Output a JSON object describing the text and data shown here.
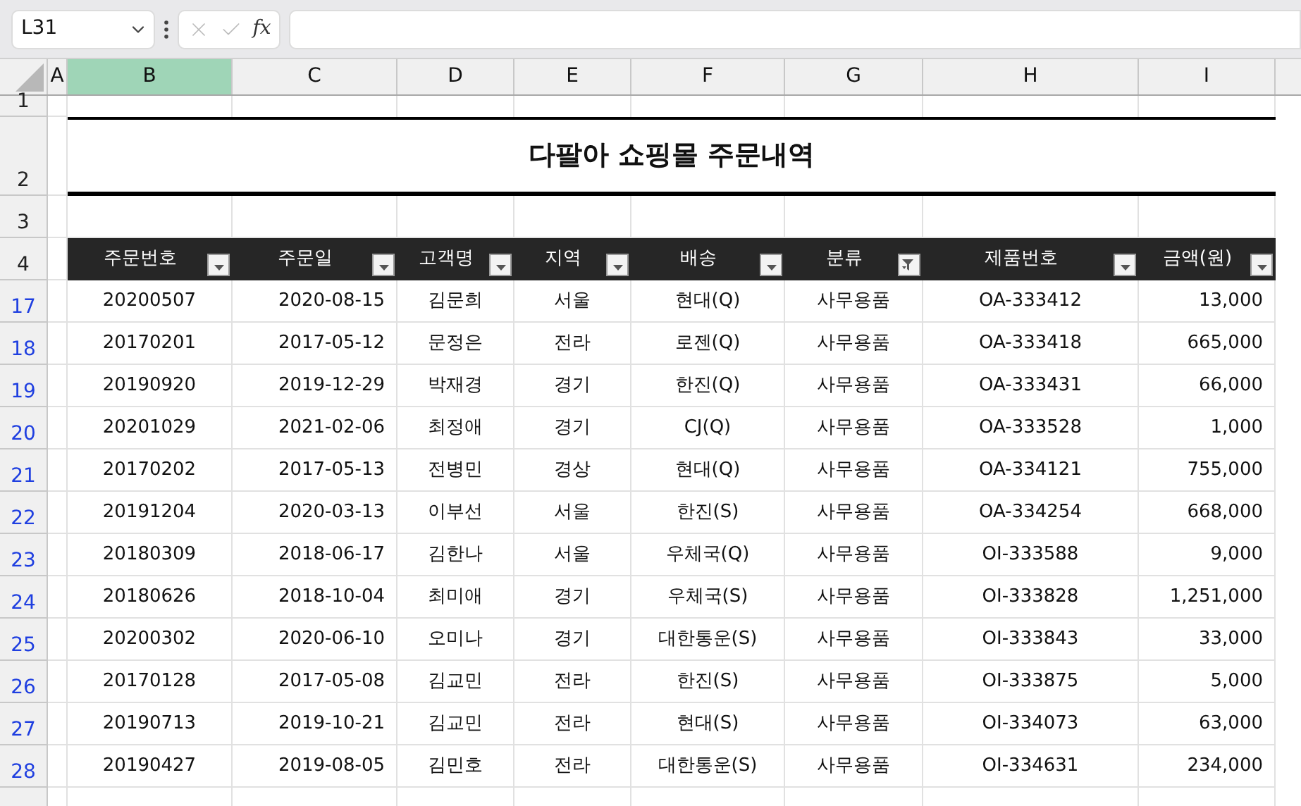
{
  "name_box": {
    "value": "L31"
  },
  "formula_bar": {
    "fx_label": "fx"
  },
  "column_headers": [
    {
      "label": "A",
      "selected": false
    },
    {
      "label": "B",
      "selected": true
    },
    {
      "label": "C",
      "selected": false
    },
    {
      "label": "D",
      "selected": false
    },
    {
      "label": "E",
      "selected": false
    },
    {
      "label": "F",
      "selected": false
    },
    {
      "label": "G",
      "selected": false
    },
    {
      "label": "H",
      "selected": false
    },
    {
      "label": "I",
      "selected": false
    }
  ],
  "top_rows": [
    "1",
    "2",
    "3",
    "4"
  ],
  "title": "다팔아 쇼핑몰 주문내역",
  "table": {
    "filtered": true,
    "columns": [
      {
        "label": "주문번호",
        "filtered": false
      },
      {
        "label": "주문일",
        "filtered": false
      },
      {
        "label": "고객명",
        "filtered": false
      },
      {
        "label": "지역",
        "filtered": false
      },
      {
        "label": "배송",
        "filtered": false
      },
      {
        "label": "분류",
        "filtered": true
      },
      {
        "label": "제품번호",
        "filtered": false
      },
      {
        "label": "금액(원)",
        "filtered": false
      }
    ],
    "rows": [
      {
        "row_number": "17",
        "cells": [
          "20200507",
          "2020-08-15",
          "김문희",
          "서울",
          "현대(Q)",
          "사무용품",
          "OA-333412",
          "13,000"
        ]
      },
      {
        "row_number": "18",
        "cells": [
          "20170201",
          "2017-05-12",
          "문정은",
          "전라",
          "로젠(Q)",
          "사무용품",
          "OA-333418",
          "665,000"
        ]
      },
      {
        "row_number": "19",
        "cells": [
          "20190920",
          "2019-12-29",
          "박재경",
          "경기",
          "한진(Q)",
          "사무용품",
          "OA-333431",
          "66,000"
        ]
      },
      {
        "row_number": "20",
        "cells": [
          "20201029",
          "2021-02-06",
          "최정애",
          "경기",
          "CJ(Q)",
          "사무용품",
          "OA-333528",
          "1,000"
        ]
      },
      {
        "row_number": "21",
        "cells": [
          "20170202",
          "2017-05-13",
          "전병민",
          "경상",
          "현대(Q)",
          "사무용품",
          "OA-334121",
          "755,000"
        ]
      },
      {
        "row_number": "22",
        "cells": [
          "20191204",
          "2020-03-13",
          "이부선",
          "서울",
          "한진(S)",
          "사무용품",
          "OA-334254",
          "668,000"
        ]
      },
      {
        "row_number": "23",
        "cells": [
          "20180309",
          "2018-06-17",
          "김한나",
          "서울",
          "우체국(Q)",
          "사무용품",
          "OI-333588",
          "9,000"
        ]
      },
      {
        "row_number": "24",
        "cells": [
          "20180626",
          "2018-10-04",
          "최미애",
          "경기",
          "우체국(S)",
          "사무용품",
          "OI-333828",
          "1,251,000"
        ]
      },
      {
        "row_number": "25",
        "cells": [
          "20200302",
          "2020-06-10",
          "오미나",
          "경기",
          "대한통운(S)",
          "사무용품",
          "OI-333843",
          "33,000"
        ]
      },
      {
        "row_number": "26",
        "cells": [
          "20170128",
          "2017-05-08",
          "김교민",
          "전라",
          "한진(S)",
          "사무용품",
          "OI-333875",
          "5,000"
        ]
      },
      {
        "row_number": "27",
        "cells": [
          "20190713",
          "2019-10-21",
          "김교민",
          "전라",
          "현대(S)",
          "사무용품",
          "OI-334073",
          "63,000"
        ]
      },
      {
        "row_number": "28",
        "cells": [
          "20190427",
          "2019-08-05",
          "김민호",
          "전라",
          "대한통운(S)",
          "사무용품",
          "OI-334631",
          "234,000"
        ]
      }
    ]
  }
}
